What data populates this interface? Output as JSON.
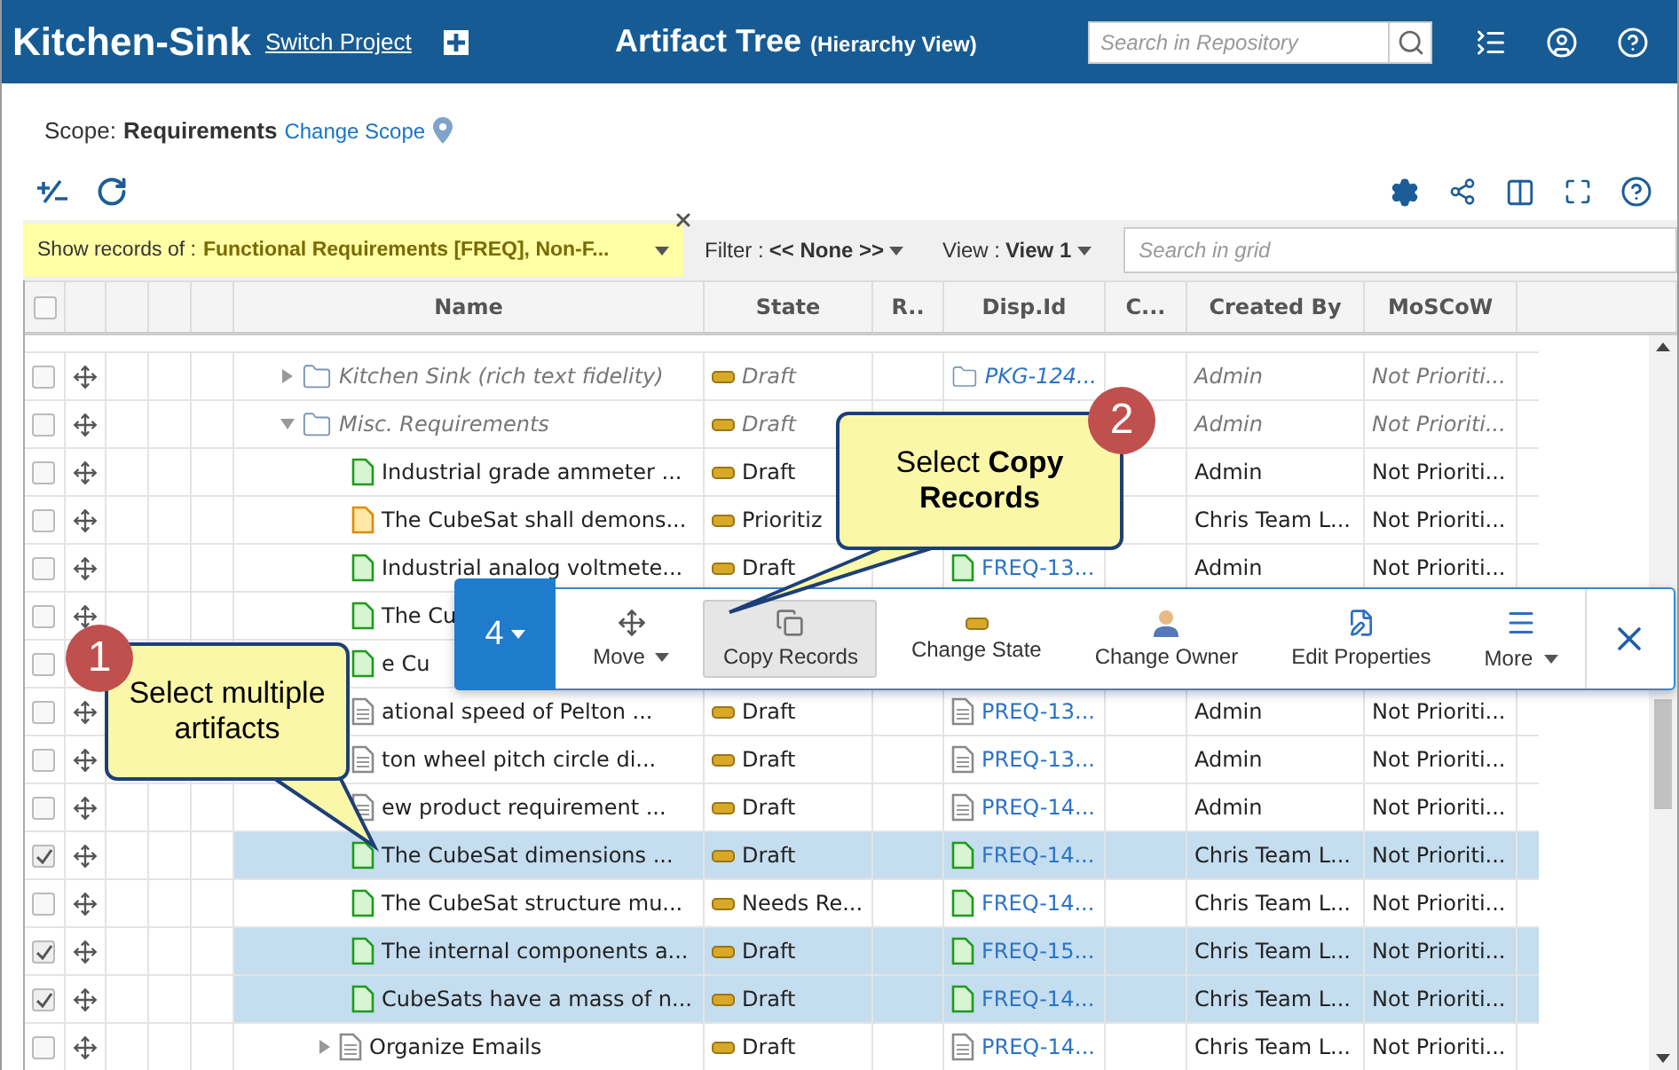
{
  "header": {
    "title": "Kitchen-Sink",
    "switch_link": "Switch Project",
    "page_title": "Artifact Tree",
    "page_subtitle": "(Hierarchy View)",
    "search": {
      "placeholder": "Search in Repository"
    }
  },
  "scope": {
    "label": "Scope:",
    "value": "Requirements",
    "link": "Change Scope"
  },
  "filters": {
    "show_records": {
      "label": "Show records of :",
      "value": "Functional Requirements [FREQ], Non-F..."
    },
    "filter": {
      "label": "Filter :",
      "value": "<< None >>"
    },
    "view": {
      "label": "View :",
      "value": "View 1"
    },
    "grid_search": {
      "placeholder": "Search in grid"
    }
  },
  "all_checked": false,
  "columns": [
    "Name",
    "State",
    "R..",
    "Disp.Id",
    "C...",
    "Created By",
    "MoSCoW"
  ],
  "rows": [
    {
      "kind": "folder",
      "expanded": false,
      "name": "Kitchen Sink (rich text fidelity)",
      "state": "Draft",
      "disp_id": "PKG-124...",
      "created_by": "Admin",
      "moscow": "Not Prioriti...",
      "checked": false
    },
    {
      "kind": "folder",
      "expanded": true,
      "name": "Misc. Requirements",
      "state": "Draft",
      "created_by": "Admin",
      "moscow": "Not Prioriti...",
      "checked": false
    },
    {
      "kind": "green",
      "name": "Industrial grade ammeter ...",
      "state": "Draft",
      "created_by": "Admin",
      "moscow": "Not Prioriti...",
      "checked": false
    },
    {
      "kind": "orange",
      "name": "The CubeSat shall demons...",
      "state": "Prioritiz",
      "created_by": "Chris Team L...",
      "moscow": "Not Prioriti...",
      "checked": false
    },
    {
      "kind": "green",
      "name": "Industrial analog voltmete...",
      "state": "Draft",
      "disp_id": "FREQ-13...",
      "created_by": "Admin",
      "moscow": "Not Prioriti...",
      "checked": false
    },
    {
      "kind": "green",
      "name": "The Cu",
      "checked": false
    },
    {
      "kind": "green",
      "name": "e Cu",
      "checked": false,
      "handle_shown": false
    },
    {
      "kind": "plain",
      "name": "ational speed of Pelton ...",
      "state": "Draft",
      "disp_id": "PREQ-13...",
      "created_by": "Admin",
      "moscow": "Not Prioriti...",
      "checked": false
    },
    {
      "kind": "plain",
      "name": "ton wheel pitch circle di...",
      "state": "Draft",
      "disp_id": "PREQ-13...",
      "created_by": "Admin",
      "moscow": "Not Prioriti...",
      "checked": false
    },
    {
      "kind": "plain",
      "name": "ew product requirement ...",
      "state": "Draft",
      "disp_id": "PREQ-14...",
      "created_by": "Admin",
      "moscow": "Not Prioriti...",
      "checked": false
    },
    {
      "kind": "green",
      "name": "The CubeSat dimensions ...",
      "state": "Draft",
      "disp_id": "FREQ-14...",
      "created_by": "Chris Team L...",
      "moscow": "Not Prioriti...",
      "checked": true
    },
    {
      "kind": "green",
      "name": "The CubeSat structure mu...",
      "state": "Needs Re...",
      "disp_id": "FREQ-14...",
      "created_by": "Chris Team L...",
      "moscow": "Not Prioriti...",
      "checked": false
    },
    {
      "kind": "green",
      "name": "The internal components a...",
      "state": "Draft",
      "disp_id": "FREQ-15...",
      "created_by": "Chris Team L...",
      "moscow": "Not Prioriti...",
      "checked": true
    },
    {
      "kind": "green",
      "name": "CubeSats have a mass of n...",
      "state": "Draft",
      "disp_id": "FREQ-14...",
      "created_by": "Chris Team L...",
      "moscow": "Not Prioriti...",
      "checked": true
    },
    {
      "kind": "plain",
      "expanded": false,
      "name": "Organize Emails",
      "state": "Draft",
      "disp_id": "PREQ-14...",
      "created_by": "Chris Team L...",
      "moscow": "Not Prioriti...",
      "checked": false
    }
  ],
  "action_bar": {
    "count": "4",
    "buttons": [
      {
        "kind": "move",
        "label": "Move",
        "selected": false
      },
      {
        "kind": "copy",
        "label": "Copy Records",
        "selected": true
      },
      {
        "kind": "state",
        "label": "Change State",
        "selected": false
      },
      {
        "kind": "owner",
        "label": "Change Owner",
        "selected": false
      },
      {
        "kind": "edit",
        "label": "Edit Properties",
        "selected": false
      },
      {
        "kind": "more",
        "label": "More",
        "selected": false
      }
    ]
  },
  "callouts": [
    {
      "number": "1",
      "text": "Select multiple artifacts"
    },
    {
      "number": "2",
      "text": "Select **Copy Records**"
    }
  ]
}
